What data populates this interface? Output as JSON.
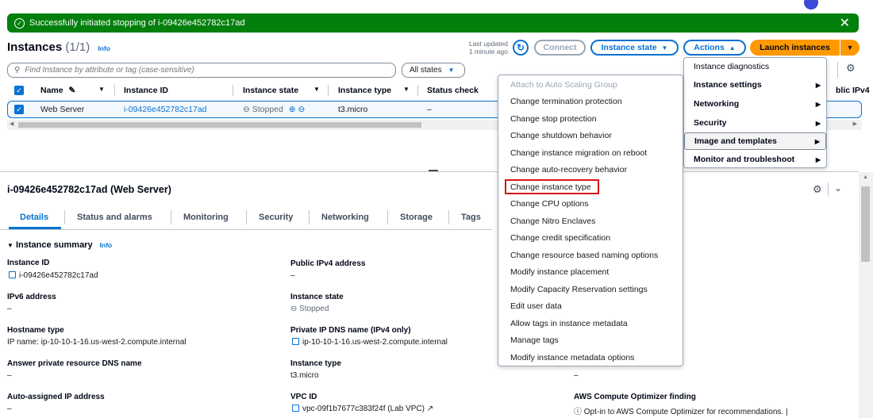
{
  "flash": {
    "message": "Successfully initiated stopping of i-09426e452782c17ad"
  },
  "header": {
    "title": "Instances",
    "count": "(1/1)",
    "info": "Info",
    "last_updated_line1": "Last updated",
    "last_updated_line2": "1 minute ago",
    "connect": "Connect",
    "instance_state": "Instance state",
    "actions": "Actions",
    "launch": "Launch instances"
  },
  "search": {
    "placeholder": "Find Instance by attribute or tag (case-sensitive)",
    "filter": "All states"
  },
  "table": {
    "columns": [
      "Name",
      "Instance ID",
      "Instance state",
      "Instance type",
      "Status check",
      "blic IPv4"
    ],
    "row": {
      "name": "Web Server",
      "id": "i-09426e452782c17ad",
      "state": "Stopped",
      "type": "t3.micro",
      "status": "–"
    }
  },
  "actions_menu": [
    "Instance diagnostics",
    "Instance settings",
    "Networking",
    "Security",
    "Image and templates",
    "Monitor and troubleshoot"
  ],
  "settings_menu": [
    "Attach to Auto Scaling Group",
    "Change termination protection",
    "Change stop protection",
    "Change shutdown behavior",
    "Change instance migration on reboot",
    "Change auto-recovery behavior",
    "Change instance type",
    "Change CPU options",
    "Change Nitro Enclaves",
    "Change credit specification",
    "Change resource based naming options",
    "Modify instance placement",
    "Modify Capacity Reservation settings",
    "Edit user data",
    "Allow tags in instance metadata",
    "Manage tags",
    "Modify instance metadata options"
  ],
  "details": {
    "title": "i-09426e452782c17ad (Web Server)",
    "tabs": [
      "Details",
      "Status and alarms",
      "Monitoring",
      "Security",
      "Networking",
      "Storage",
      "Tags"
    ],
    "summary": "Instance summary",
    "info": "Info",
    "fields": {
      "instance_id_label": "Instance ID",
      "instance_id": "i-09426e452782c17ad",
      "public_ipv4_label": "Public IPv4 address",
      "public_ipv4": "–",
      "ipv6_label": "IPv6 address",
      "ipv6": "–",
      "state_label": "Instance state",
      "state": "Stopped",
      "hostname_label": "Hostname type",
      "hostname": "IP name: ip-10-10-1-16.us-west-2.compute.internal",
      "private_dns_label": "Private IP DNS name (IPv4 only)",
      "private_dns": "ip-10-10-1-16.us-west-2.compute.internal",
      "answer_dns_label": "Answer private resource DNS name",
      "answer_dns": "–",
      "type_label": "Instance type",
      "type": "t3.micro",
      "right_dash": "–",
      "auto_ip_label": "Auto-assigned IP address",
      "auto_ip": "–",
      "vpc_label": "VPC ID",
      "vpc": "vpc-09f1b7677c383f24f (Lab VPC)",
      "optimizer_label": "AWS Compute Optimizer finding",
      "optimizer": "Opt-in to AWS Compute Optimizer for recommendations."
    }
  }
}
